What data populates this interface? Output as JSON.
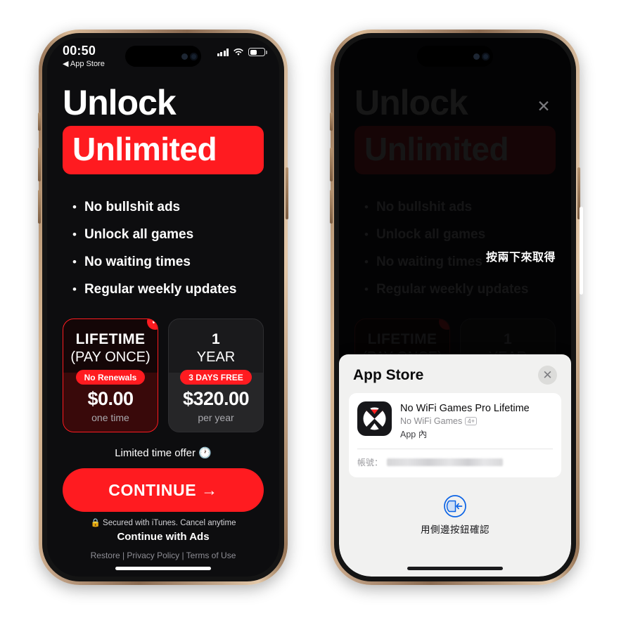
{
  "status_bar": {
    "time": "00:50",
    "back_label": "App Store",
    "back_arrow": "◀",
    "signal_icon": "cellular-bars-icon",
    "wifi_icon": "wifi-icon",
    "battery_icon": "battery-icon"
  },
  "paywall": {
    "heading_line1": "Unlock",
    "heading_line2": "Unlimited",
    "features": [
      {
        "bullet": "•",
        "label": "No bullshit ads"
      },
      {
        "bullet": "•",
        "label": "Unlock all games"
      },
      {
        "bullet": "•",
        "label": "No waiting times"
      },
      {
        "bullet": "•",
        "label": "Regular weekly updates"
      }
    ],
    "plans": [
      {
        "title": "LIFETIME",
        "subtitle": "(PAY ONCE)",
        "badge": "No Renewals",
        "price": "$0.00",
        "period": "one time",
        "selected": true,
        "check_glyph": "✔"
      },
      {
        "title": "1",
        "subtitle": "YEAR",
        "badge": "3 DAYS FREE",
        "price": "$320.00",
        "period": "per year",
        "selected": false,
        "check_glyph": ""
      }
    ],
    "limited_offer": "Limited time offer 🕐",
    "cta_label": "CONTINUE  →",
    "secured_note": "🔒 Secured with iTunes. Cancel anytime",
    "continue_with_ads": "Continue with Ads",
    "legal_links": "Restore  |  Privacy Policy  |  Terms of Use",
    "close_glyph": "✕"
  },
  "purchase_overlay": {
    "double_click_hint": "按兩下來取得",
    "side_button_indicator": "side-button-highlight"
  },
  "sheet": {
    "title": "App Store",
    "close_glyph": "✕",
    "product": {
      "name": "No WiFi Games Pro Lifetime",
      "developer": "No WiFi Games",
      "age_rating": "4+",
      "in_app_label": "App 內",
      "icon": "no-wifi-games-app-icon"
    },
    "account_label": "帳號：",
    "account_value_masked": "",
    "confirm_text": "用側邊按鈕確認",
    "confirm_icon": "side-button-confirm-icon"
  },
  "colors": {
    "brand_red": "#FF1B20",
    "screen_bg": "#0d0d0f",
    "sheet_bg": "#f1f1f0",
    "frame_gold": "#c0a084"
  }
}
